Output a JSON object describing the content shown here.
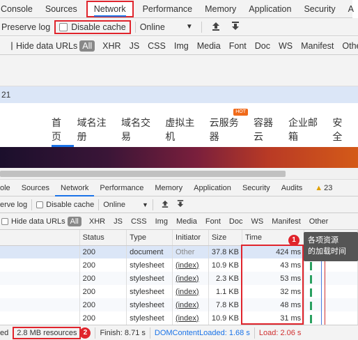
{
  "top_tabs": [
    "Console",
    "Sources",
    "Network",
    "Performance",
    "Memory",
    "Application",
    "Security",
    "A"
  ],
  "top_toolbar": {
    "preserve_log": "Preserve log",
    "disable_cache": "Disable cache",
    "throttle": "Online",
    "dropdown": "▼"
  },
  "filter_bar": {
    "hide_data_urls": "Hide data URLs",
    "chips": [
      "All",
      "XHR",
      "JS",
      "CSS",
      "Img",
      "Media",
      "Font",
      "Doc",
      "WS",
      "Manifest",
      "Other"
    ]
  },
  "blue_row_text": "21",
  "site_nav": {
    "items": [
      "首页",
      "域名注册",
      "域名交易",
      "虚拟主机",
      "云服务器",
      "容器云",
      "企业邮箱",
      "安全"
    ],
    "hot_badge": "HOT"
  },
  "bottom_tabs": [
    "ole",
    "Sources",
    "Network",
    "Performance",
    "Memory",
    "Application",
    "Security",
    "Audits"
  ],
  "warning_count": "23",
  "bottom_toolbar": {
    "preserve_log": "erve log",
    "disable_cache": "Disable cache",
    "throttle": "Online",
    "dropdown": "▼"
  },
  "bottom_filter": {
    "hide_data_urls": "Hide data URLs",
    "chips": [
      "All",
      "XHR",
      "JS",
      "CSS",
      "Img",
      "Media",
      "Font",
      "Doc",
      "WS",
      "Manifest",
      "Other"
    ]
  },
  "table": {
    "headers": [
      "Status",
      "Type",
      "Initiator",
      "Size",
      "Time"
    ],
    "rows": [
      {
        "status": "200",
        "type": "document",
        "initiator": "Other",
        "size": "37.8 KB",
        "time": "424 ms"
      },
      {
        "status": "200",
        "type": "stylesheet",
        "initiator": "(index)",
        "size": "10.9 KB",
        "time": "43 ms"
      },
      {
        "status": "200",
        "type": "stylesheet",
        "initiator": "(index)",
        "size": "2.3 KB",
        "time": "53 ms"
      },
      {
        "status": "200",
        "type": "stylesheet",
        "initiator": "(index)",
        "size": "1.1 KB",
        "time": "32 ms"
      },
      {
        "status": "200",
        "type": "stylesheet",
        "initiator": "(index)",
        "size": "7.8 KB",
        "time": "48 ms"
      },
      {
        "status": "200",
        "type": "stylesheet",
        "initiator": "(index)",
        "size": "10.9 KB",
        "time": "31 ms"
      }
    ]
  },
  "annotation1": {
    "badge": "1",
    "line1": "各项资源",
    "line2": "的加载时间"
  },
  "status_bar": {
    "prefix": "ed",
    "resources": "2.8 MB resources",
    "badge": "2",
    "finish": "Finish: 8.71 s",
    "dom": "DOMContentLoaded: 1.68 s",
    "load": "Load: 2.06 s"
  },
  "colors": {
    "highlight_red": "#e0242c",
    "accent_blue": "#1a73e8",
    "selected_row": "#dbe6f7"
  }
}
